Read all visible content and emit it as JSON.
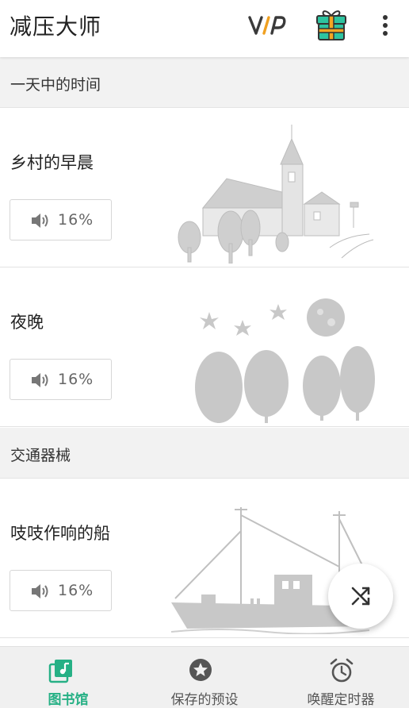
{
  "app": {
    "title": "减压大师",
    "vip_label": "VIP"
  },
  "sections": [
    {
      "header": "一天中的时间",
      "cards": [
        {
          "title": "乡村的早晨",
          "volume": "16%",
          "art": "village-church-icon"
        },
        {
          "title": "夜晚",
          "volume": "16%",
          "art": "night-trees-icon"
        }
      ]
    },
    {
      "header": "交通器械",
      "cards": [
        {
          "title": "吱吱作响的船",
          "volume": "16%",
          "art": "creaky-boat-icon"
        }
      ]
    }
  ],
  "fab": {
    "icon": "shuffle-icon"
  },
  "bottom_nav": [
    {
      "label": "图书馆",
      "icon": "library-music-icon",
      "active": true
    },
    {
      "label": "保存的预设",
      "icon": "star-circle-icon",
      "active": false
    },
    {
      "label": "唤醒定时器",
      "icon": "alarm-clock-icon",
      "active": false
    }
  ],
  "colors": {
    "accent": "#26b085",
    "icon_gray": "#555555",
    "art_gray": "#c8c8c8",
    "vip_v_and_p": "#3a3a3a",
    "vip_i": "#f0a020",
    "gift_box": "#2ec4a0",
    "gift_ribbon": "#f5a623"
  }
}
